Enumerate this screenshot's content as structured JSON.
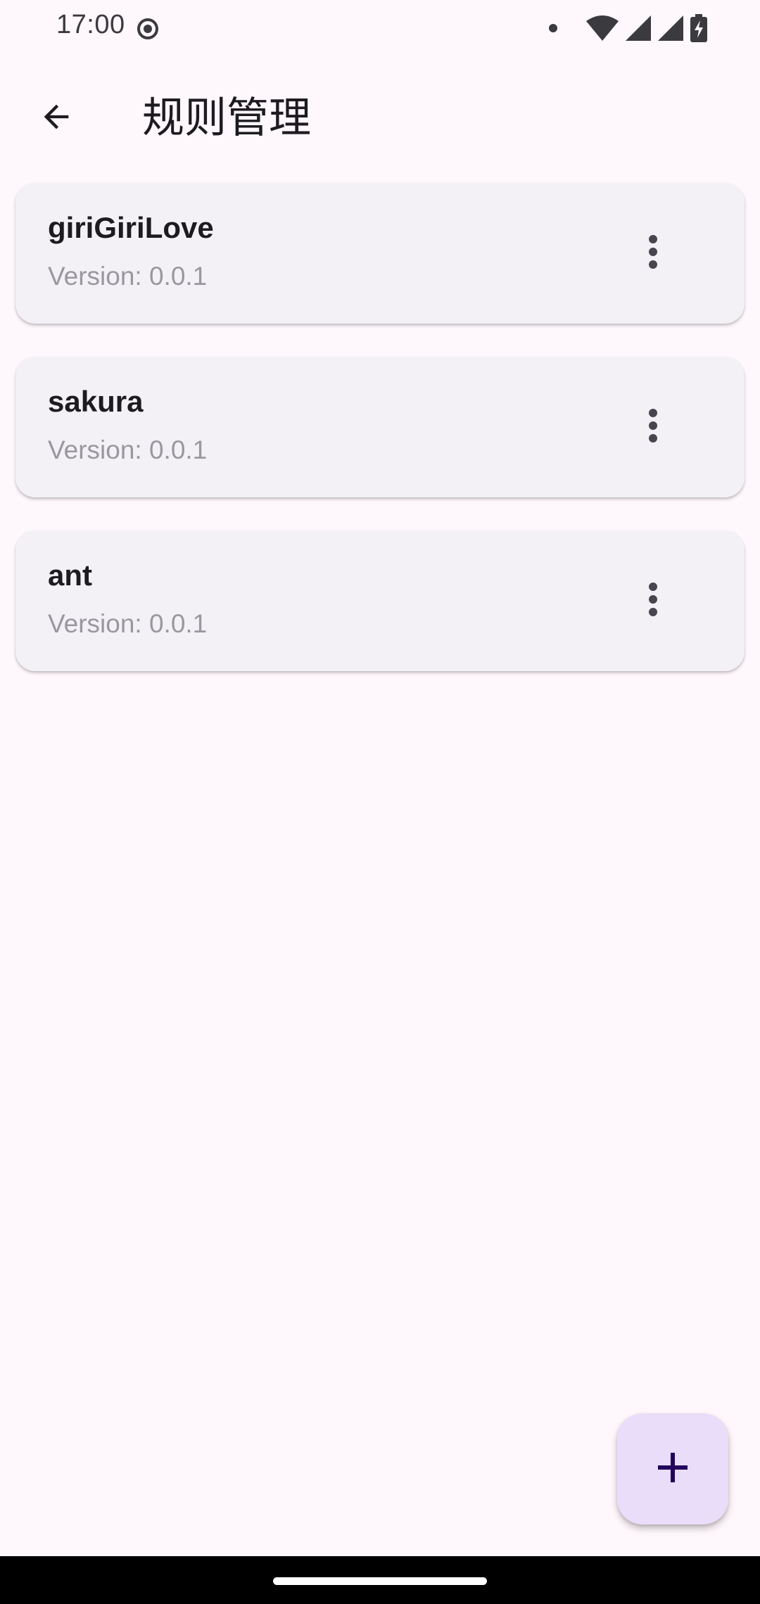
{
  "status_bar": {
    "time": "17:00",
    "icons": [
      "target-icon",
      "notification-dot-icon",
      "wifi-icon",
      "signal-icon",
      "signal-icon",
      "battery-charging-icon"
    ]
  },
  "app_bar": {
    "title": "规则管理",
    "back_icon": "arrow-back-icon"
  },
  "rules": [
    {
      "name": "giriGiriLove",
      "version": "Version: 0.0.1"
    },
    {
      "name": "sakura",
      "version": "Version: 0.0.1"
    },
    {
      "name": "ant",
      "version": "Version: 0.0.1"
    }
  ],
  "fab": {
    "icon": "add-icon"
  },
  "colors": {
    "background": "#fef7fb",
    "card": "#f4f1f6",
    "fab": "#e9ddfa",
    "fab_icon": "#21005d",
    "secondary_text": "#9a979e"
  }
}
